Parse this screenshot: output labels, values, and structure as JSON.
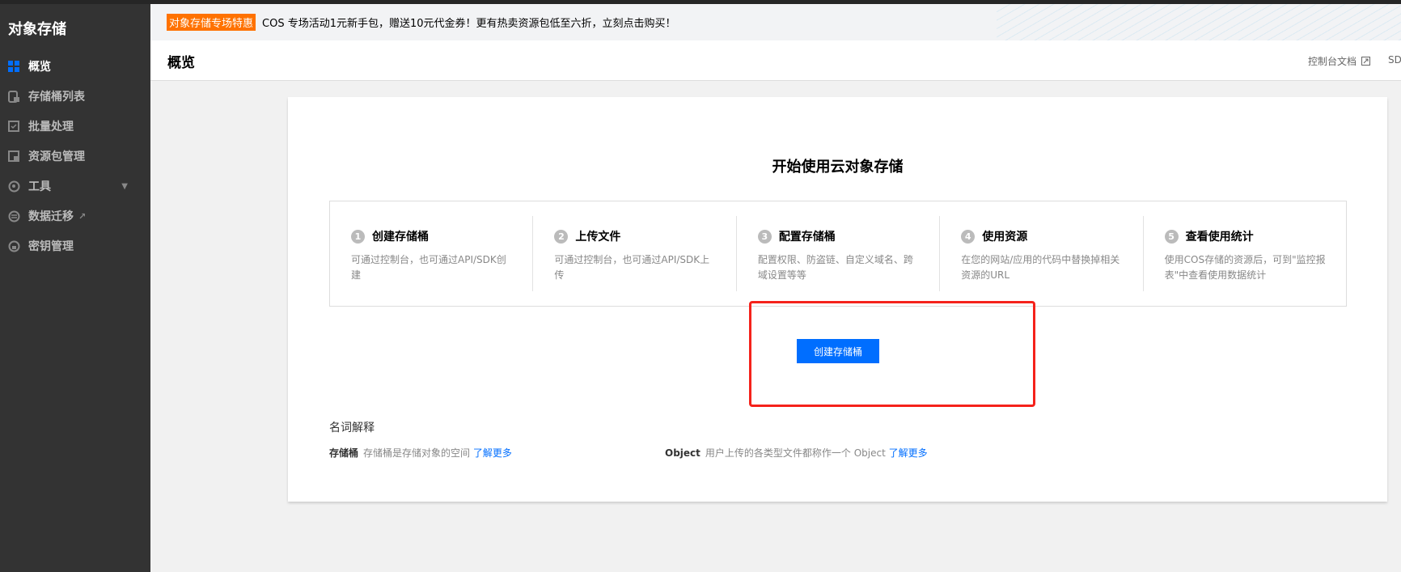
{
  "sidebar": {
    "title": "对象存储",
    "items": [
      {
        "label": "概览",
        "icon": "grid-icon",
        "active": true
      },
      {
        "label": "存储桶列表",
        "icon": "bucket-icon"
      },
      {
        "label": "批量处理",
        "icon": "checkbox-icon"
      },
      {
        "label": "资源包管理",
        "icon": "package-icon"
      },
      {
        "label": "工具",
        "icon": "wrench-icon",
        "caret": "▼"
      },
      {
        "label": "数据迁移",
        "icon": "migrate-icon",
        "external": "↗"
      },
      {
        "label": "密钥管理",
        "icon": "lock-icon"
      }
    ]
  },
  "banner": {
    "tag": "对象存储专场特惠",
    "text": "COS 专场活动1元新手包，赠送10元代金券！更有热卖资源包低至六折，立刻点击购买！"
  },
  "header": {
    "title": "概览",
    "links": [
      {
        "label": "控制台文档",
        "icon": "external-link-icon"
      },
      {
        "label": "SD"
      }
    ]
  },
  "main": {
    "title": "开始使用云对象存储",
    "steps": [
      {
        "num": "1",
        "title": "创建存储桶",
        "desc": "可通过控制台，也可通过API/SDK创建"
      },
      {
        "num": "2",
        "title": "上传文件",
        "desc": "可通过控制台，也可通过API/SDK上传"
      },
      {
        "num": "3",
        "title": "配置存储桶",
        "desc": "配置权限、防盗链、自定义域名、跨域设置等等"
      },
      {
        "num": "4",
        "title": "使用资源",
        "desc": "在您的网站/应用的代码中替换掉相关资源的URL"
      },
      {
        "num": "5",
        "title": "查看使用统计",
        "desc": "使用COS存储的资源后，可到\"监控报表\"中查看使用数据统计"
      }
    ],
    "create_button": "创建存储桶",
    "terms_title": "名词解释",
    "terms": [
      {
        "term": "存储桶",
        "desc": "存储桶是存储对象的空间",
        "link": "了解更多"
      },
      {
        "term": "Object",
        "desc": "用户上传的各类型文件都称作一个 Object",
        "link": "了解更多"
      }
    ]
  },
  "colors": {
    "accent": "#006eff",
    "sidebar": "#333333",
    "tag": "#ff7200",
    "highlight": "#f5221b"
  }
}
